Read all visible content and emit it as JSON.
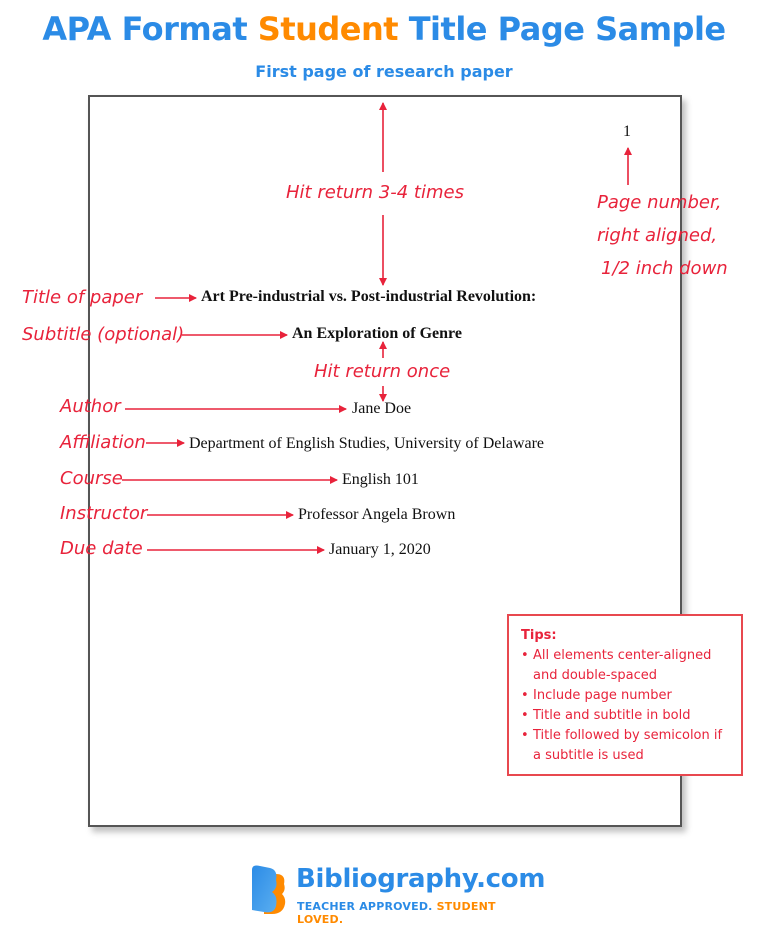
{
  "header": {
    "title_part1": "APA Format ",
    "title_accent": "Student",
    "title_part2": " Title Page Sample",
    "subtitle": "First page of research paper"
  },
  "colors": {
    "brand_blue": "#2b8be6",
    "brand_orange": "#ff8a00",
    "annotation_red": "#e8233b"
  },
  "page": {
    "page_number": "1",
    "title": "Art Pre-industrial vs. Post-industrial Revolution:",
    "subtitle": "An Exploration of Genre",
    "author": "Jane Doe",
    "affiliation": "Department of English Studies, University of Delaware",
    "course": "English 101",
    "instructor": "Professor Angela Brown",
    "due_date": "January 1, 2020"
  },
  "annotations": {
    "hit_return_top": "Hit return 3-4 times",
    "page_number_note_1": "Page number,",
    "page_number_note_2": "right aligned,",
    "page_number_note_3": "1/2 inch down",
    "title_label": "Title of paper",
    "subtitle_label": "Subtitle (optional)",
    "hit_return_once": "Hit return once",
    "author_label": "Author",
    "affiliation_label": "Affiliation",
    "course_label": "Course",
    "instructor_label": "Instructor",
    "due_date_label": "Due date"
  },
  "tips": {
    "title": "Tips:",
    "items": [
      "All elements center-aligned and double-spaced",
      "Include page number",
      "Title and subtitle in bold",
      "Title followed by semicolon if a subtitle is used"
    ]
  },
  "logo": {
    "name": "Bibliography.com",
    "tagline_part1": "TEACHER APPROVED. ",
    "tagline_part2": "STUDENT LOVED."
  }
}
